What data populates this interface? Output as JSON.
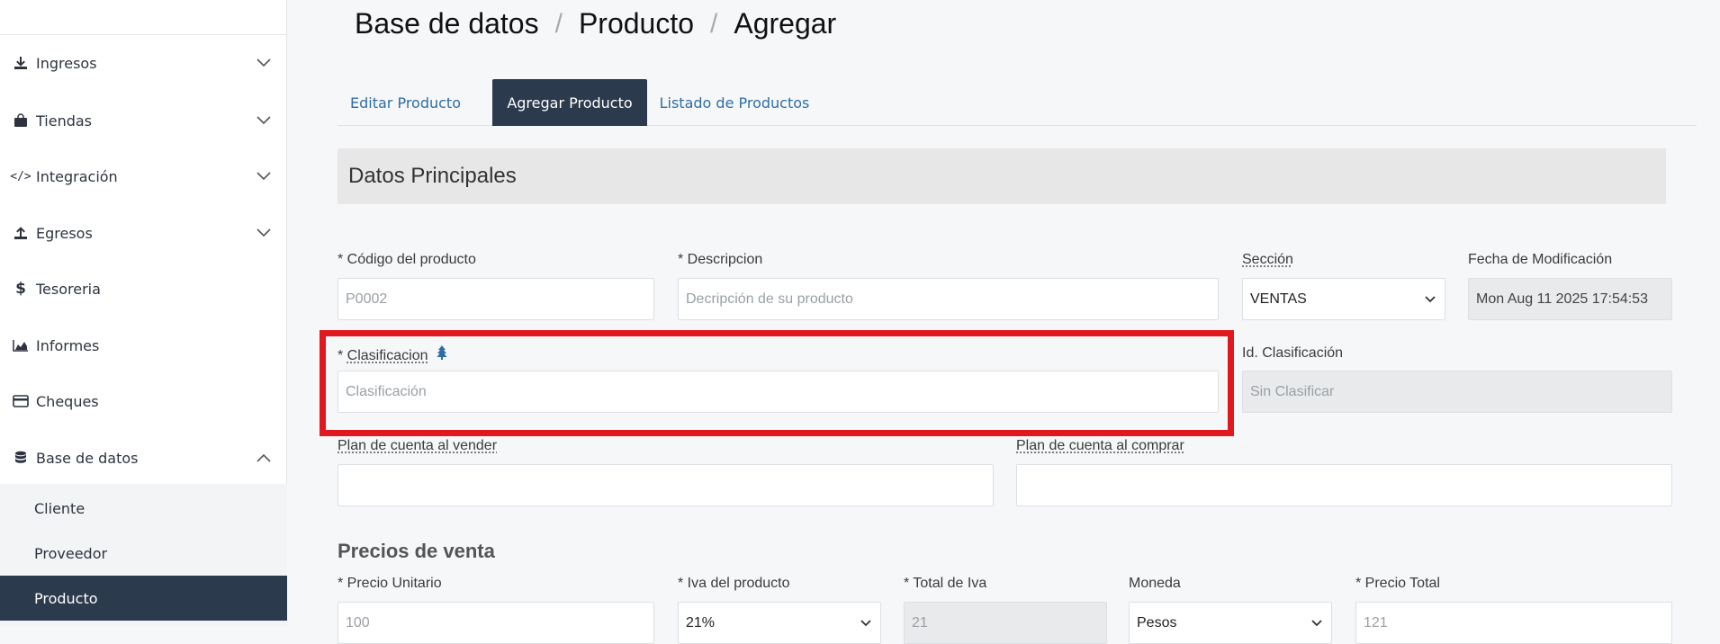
{
  "sidebar": {
    "items": [
      {
        "label": "Ingresos",
        "icon": "download-icon",
        "expanded": false
      },
      {
        "label": "Tiendas",
        "icon": "shopping-bag-icon",
        "expanded": false
      },
      {
        "label": "Integración",
        "icon": "code-icon",
        "expanded": false
      },
      {
        "label": "Egresos",
        "icon": "upload-icon",
        "expanded": false
      },
      {
        "label": "Tesoreria",
        "icon": "dollar-icon"
      },
      {
        "label": "Informes",
        "icon": "area-chart-icon"
      },
      {
        "label": "Cheques",
        "icon": "credit-card-icon"
      },
      {
        "label": "Base de datos",
        "icon": "database-icon",
        "expanded": true
      }
    ],
    "subitems": [
      {
        "label": "Cliente",
        "active": false
      },
      {
        "label": "Proveedor",
        "active": false
      },
      {
        "label": "Producto",
        "active": true
      }
    ]
  },
  "breadcrumb": [
    "Base de datos",
    "Producto",
    "Agregar"
  ],
  "breadcrumb_separator": "/",
  "tabs": [
    {
      "label": "Editar Producto",
      "active": false
    },
    {
      "label": "Agregar Producto",
      "active": true
    },
    {
      "label": "Listado de Productos",
      "active": false
    }
  ],
  "section_title": "Datos Principales",
  "form": {
    "codigo": {
      "label": "* Código del producto",
      "placeholder": "P0002"
    },
    "descripcion": {
      "label": "* Descripcion",
      "placeholder": "Decripción de su producto"
    },
    "seccion": {
      "label": "Sección",
      "value": "VENTAS"
    },
    "fecha_mod": {
      "label": "Fecha de Modificación",
      "value": "Mon Aug 11 2025 17:54:53"
    },
    "clasificacion": {
      "label_prefix": "* ",
      "label": "Clasificacion",
      "placeholder": "Clasificación"
    },
    "id_clasificacion": {
      "label": "Id. Clasificación",
      "value": "Sin Clasificar"
    },
    "plan_vender": {
      "label": "Plan de cuenta al vender",
      "value": ""
    },
    "plan_comprar": {
      "label": "Plan de cuenta al comprar",
      "value": ""
    }
  },
  "prices_title": "Precios de venta",
  "prices": {
    "precio_unitario": {
      "label": "* Precio Unitario",
      "placeholder": "100"
    },
    "iva": {
      "label": "* Iva del producto",
      "value": "21%"
    },
    "total_iva": {
      "label": "* Total de Iva",
      "value": "21"
    },
    "moneda": {
      "label": "Moneda",
      "value": "Pesos"
    },
    "precio_total": {
      "label": "* Precio Total",
      "placeholder": "121"
    }
  },
  "colors": {
    "sidebar_active": "#2c3a4e",
    "link": "#2e6ea6",
    "highlight": "#e0181f"
  }
}
